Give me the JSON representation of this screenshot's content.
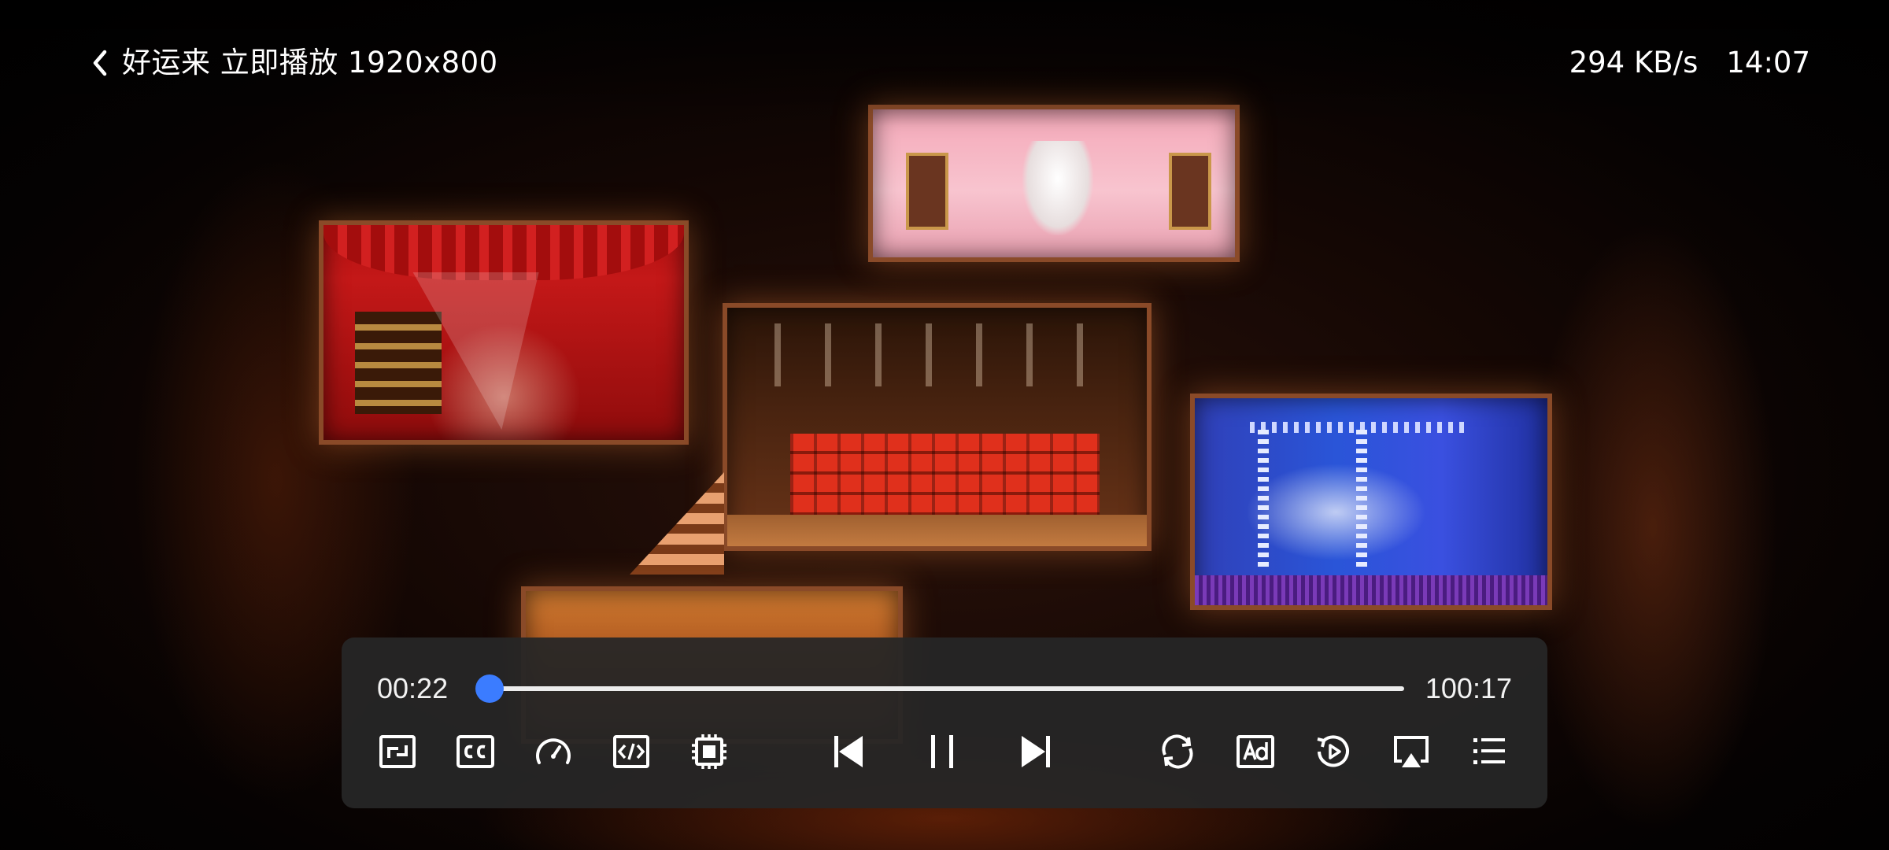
{
  "header": {
    "title": "好运来 立即播放 1920x800",
    "network_speed": "294 KB/s",
    "clock": "14:07"
  },
  "player": {
    "current_time": "00:22",
    "total_time": "100:17",
    "progress": 0.004,
    "accent_color": "#3b7cff"
  },
  "controls": {
    "left": [
      {
        "name": "aspect-ratio-icon"
      },
      {
        "name": "subtitles-cc-icon"
      },
      {
        "name": "playback-speed-icon"
      },
      {
        "name": "decoder-code-icon"
      },
      {
        "name": "hardware-chip-icon"
      }
    ],
    "center": [
      {
        "name": "skip-previous-icon"
      },
      {
        "name": "pause-icon"
      },
      {
        "name": "skip-next-icon"
      }
    ],
    "right": [
      {
        "name": "loop-icon"
      },
      {
        "name": "ad-icon"
      },
      {
        "name": "replay-icon"
      },
      {
        "name": "airplay-cast-icon"
      },
      {
        "name": "playlist-icon"
      }
    ]
  }
}
